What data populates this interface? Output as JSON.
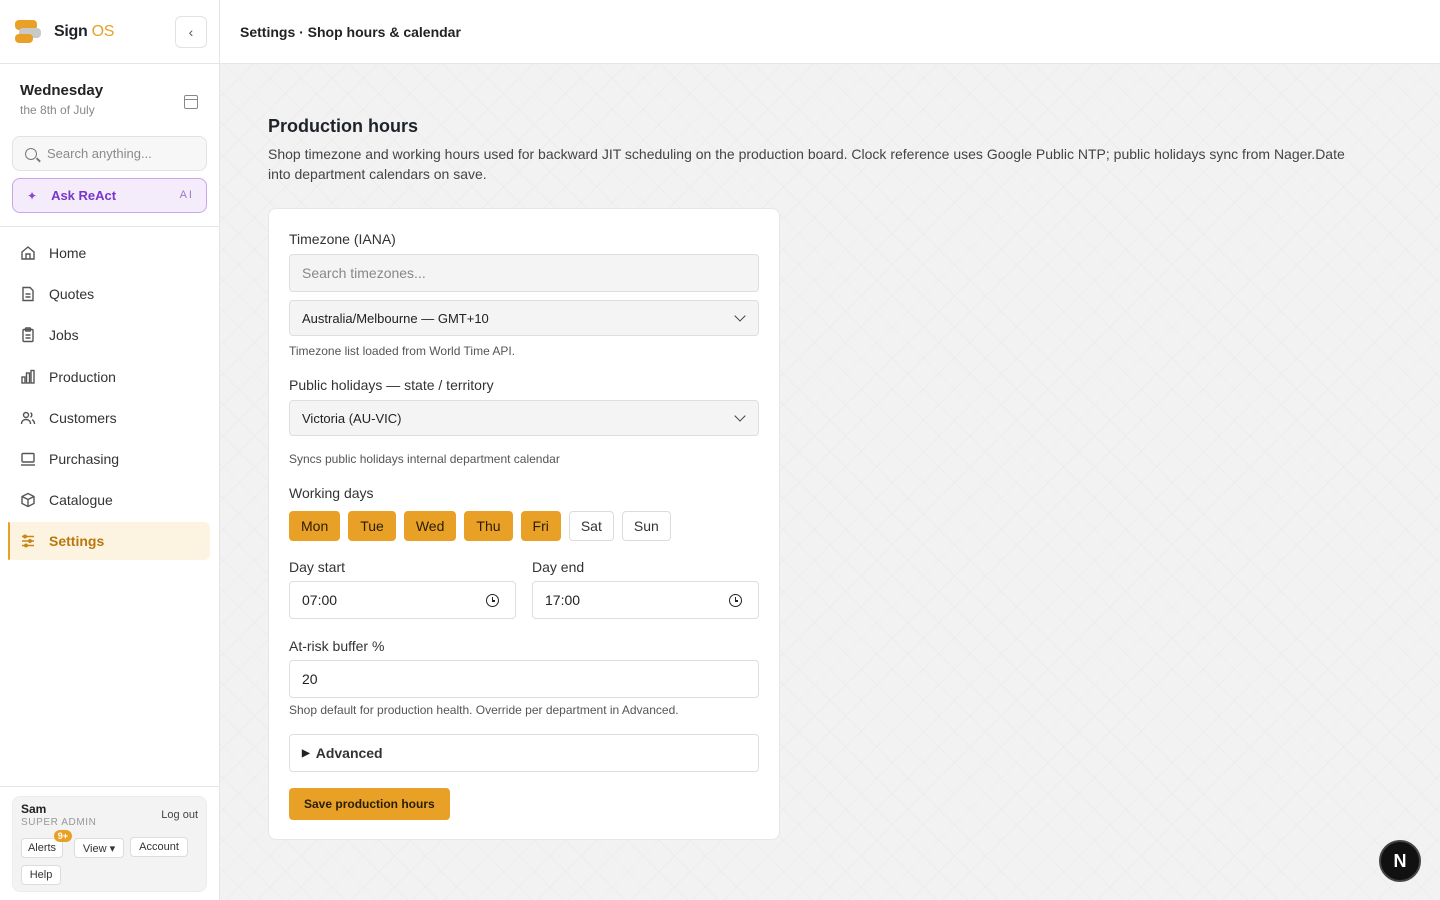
{
  "brand": {
    "name": "Sign",
    "suffix": "OS"
  },
  "sidebar": {
    "date": {
      "day": "Wednesday",
      "sub": "the 8th of July"
    },
    "search_placeholder": "Search anything...",
    "ask": {
      "label": "Ask ReAct",
      "badge": "AI"
    },
    "items": [
      {
        "label": "Home",
        "icon": "home-icon"
      },
      {
        "label": "Quotes",
        "icon": "document-icon"
      },
      {
        "label": "Jobs",
        "icon": "clipboard-icon"
      },
      {
        "label": "Production",
        "icon": "bar-chart-icon"
      },
      {
        "label": "Customers",
        "icon": "users-icon"
      },
      {
        "label": "Purchasing",
        "icon": "monitor-icon"
      },
      {
        "label": "Catalogue",
        "icon": "box-icon"
      },
      {
        "label": "Settings",
        "icon": "sliders-icon",
        "active": true
      }
    ],
    "user": {
      "name": "Sam",
      "role": "SUPER ADMIN",
      "logout": "Log out",
      "alerts": "Alerts",
      "alerts_badge": "9+",
      "view": "View ▾",
      "account": "Account",
      "help": "Help"
    }
  },
  "header": {
    "breadcrumb": "Settings · Shop hours & calendar"
  },
  "main": {
    "title": "Production hours",
    "description": "Shop timezone and working hours used for backward JIT scheduling on the production board. Clock reference uses Google Public NTP; public holidays sync from Nager.Date into department calendars on save.",
    "timezone": {
      "label": "Timezone (IANA)",
      "search_placeholder": "Search timezones...",
      "selected": "Australia/Melbourne — GMT+10",
      "hint": "Timezone list loaded from World Time API."
    },
    "holidays": {
      "label": "Public holidays — state / territory",
      "selected": "Victoria (AU-VIC)",
      "hint": "Syncs public holidays internal department calendar"
    },
    "working_days": {
      "label": "Working days",
      "days": [
        {
          "label": "Mon",
          "on": true
        },
        {
          "label": "Tue",
          "on": true
        },
        {
          "label": "Wed",
          "on": true
        },
        {
          "label": "Thu",
          "on": true
        },
        {
          "label": "Fri",
          "on": true
        },
        {
          "label": "Sat",
          "on": false
        },
        {
          "label": "Sun",
          "on": false
        }
      ]
    },
    "day_start": {
      "label": "Day start",
      "value": "07:00"
    },
    "day_end": {
      "label": "Day end",
      "value": "17:00"
    },
    "buffer": {
      "label": "At-risk buffer %",
      "value": "20",
      "hint": "Shop default for production health. Override per department in Advanced."
    },
    "advanced_label": "Advanced",
    "save_label": "Save production hours"
  },
  "dev_badge": "N",
  "colors": {
    "accent": "#e8a126",
    "ai": "#7a36c9"
  }
}
